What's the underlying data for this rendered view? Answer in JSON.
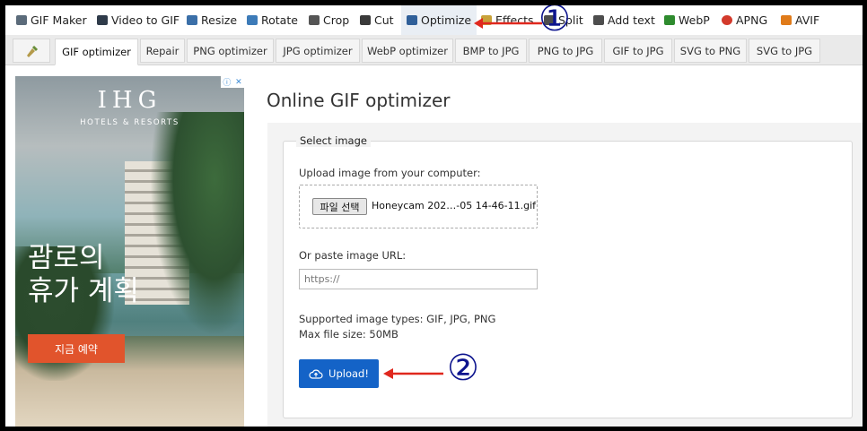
{
  "top_nav": [
    {
      "label": "GIF Maker",
      "icon": "gif-maker-icon",
      "color": "#5b6b7a"
    },
    {
      "label": "Video to GIF",
      "icon": "film-icon",
      "color": "#2f3b4a"
    },
    {
      "label": "Resize",
      "icon": "resize-icon",
      "color": "#3b6fa8"
    },
    {
      "label": "Rotate",
      "icon": "rotate-icon",
      "color": "#3d7bb8"
    },
    {
      "label": "Crop",
      "icon": "crop-icon",
      "color": "#555"
    },
    {
      "label": "Cut",
      "icon": "cut-icon",
      "color": "#3a3a3a"
    },
    {
      "label": "Optimize",
      "icon": "optimize-icon",
      "color": "#2f5f99",
      "active": true
    },
    {
      "label": "Effects",
      "icon": "effects-icon",
      "color": "#c8a23a"
    },
    {
      "label": "Split",
      "icon": "split-icon",
      "color": "#4d4d4d"
    },
    {
      "label": "Add text",
      "icon": "add-text-icon",
      "color": "#4d4d4d"
    },
    {
      "label": "WebP",
      "icon": "webp-icon",
      "color": "#2e8b2e"
    },
    {
      "label": "APNG",
      "icon": "apng-icon",
      "color": "#d33a2c"
    },
    {
      "label": "AVIF",
      "icon": "avif-icon",
      "color": "#e07b1a"
    }
  ],
  "sub_nav": [
    {
      "label": "GIF optimizer",
      "active": true
    },
    {
      "label": "Repair"
    },
    {
      "label": "PNG optimizer"
    },
    {
      "label": "JPG optimizer"
    },
    {
      "label": "WebP optimizer"
    },
    {
      "label": "BMP to JPG"
    },
    {
      "label": "PNG to JPG"
    },
    {
      "label": "GIF to JPG"
    },
    {
      "label": "SVG to PNG"
    },
    {
      "label": "SVG to JPG"
    }
  ],
  "ad": {
    "brand": "IHG",
    "brand_sub": "HOTELS & RESORTS",
    "headline": "괌로의\n휴가 계획",
    "cta": "지금 예약",
    "accent": "#e1542c"
  },
  "main": {
    "title": "Online GIF optimizer",
    "legend": "Select image",
    "upload_label": "Upload image from your computer:",
    "file_button": "파일 선택",
    "file_name": "Honeycam 202…-05 14-46-11.gif",
    "url_label": "Or paste image URL:",
    "url_placeholder": "https://",
    "supported": "Supported image types: GIF, JPG, PNG",
    "max_size": "Max file size: 50MB",
    "upload_button": "Upload!",
    "button_color": "#1463c7"
  },
  "annotations": {
    "marker1": "①",
    "marker2": "②",
    "arrow_color": "#e0281e"
  }
}
